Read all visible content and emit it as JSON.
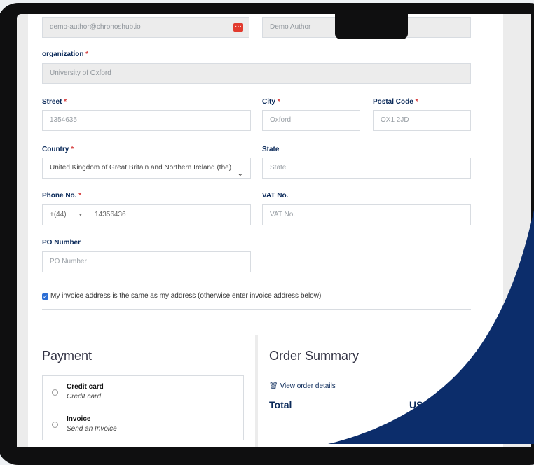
{
  "top_row": {
    "email": "demo-author@chronoshub.io",
    "name": "Demo Author"
  },
  "organization": {
    "label": "organization",
    "required_mark": "*",
    "value": "University of Oxford"
  },
  "street": {
    "label": "Street",
    "required_mark": "*",
    "value": "1354635"
  },
  "city": {
    "label": "City",
    "required_mark": "*",
    "value": "Oxford"
  },
  "postal": {
    "label": "Postal Code",
    "required_mark": "*",
    "value": "OX1 2JD"
  },
  "country": {
    "label": "Country",
    "required_mark": "*",
    "selected": "United Kingdom of Great Britain and Northern Ireland (the)"
  },
  "state": {
    "label": "State",
    "placeholder": "State"
  },
  "phone": {
    "label": "Phone No.",
    "required_mark": "*",
    "prefix": "+(44)",
    "value": "14356436"
  },
  "vat": {
    "label": "VAT No.",
    "placeholder": "VAT No."
  },
  "po": {
    "label": "PO Number",
    "placeholder": "PO Number"
  },
  "invoice_checkbox": {
    "checked": true,
    "label": "My invoice address is the same as my address (otherwise enter invoice address below)"
  },
  "payment": {
    "title": "Payment",
    "options": [
      {
        "title": "Credit card",
        "subtitle": "Credit card"
      },
      {
        "title": "Invoice",
        "subtitle": "Send an Invoice"
      }
    ]
  },
  "summary": {
    "title": "Order Summary",
    "view_details": "View order details",
    "total_label": "Total",
    "total_value_partial": "US"
  },
  "colors": {
    "navy": "#0b2a5a",
    "required": "#d43636",
    "checkbox_blue": "#2c6ed5",
    "decor_blue": "#0c2d6b"
  }
}
